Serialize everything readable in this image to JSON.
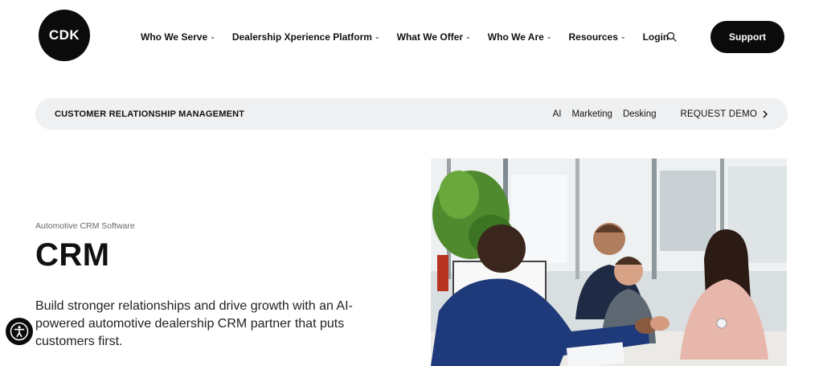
{
  "header": {
    "logo_text": "CDK",
    "nav": [
      {
        "label": "Who We Serve",
        "has_dropdown": true
      },
      {
        "label": "Dealership Xperience Platform",
        "has_dropdown": true
      },
      {
        "label": "What We Offer",
        "has_dropdown": true
      },
      {
        "label": "Who We Are",
        "has_dropdown": true
      },
      {
        "label": "Resources",
        "has_dropdown": true
      },
      {
        "label": "Login",
        "has_dropdown": false
      }
    ],
    "search_icon": "search-icon",
    "support_label": "Support"
  },
  "subnav": {
    "title": "CUSTOMER RELATIONSHIP MANAGEMENT",
    "links": [
      "AI",
      "Marketing",
      "Desking"
    ],
    "demo_label": "REQUEST DEMO",
    "demo_icon": "chevron-right-icon"
  },
  "hero": {
    "eyebrow": "Automotive CRM Software",
    "title": "CRM",
    "description": "Build stronger relationships and drive growth with an AI-powered automotive dealership CRM partner that puts customers first."
  },
  "accessibility": {
    "icon": "accessibility-icon"
  },
  "colors": {
    "brand": "#0b0b0b",
    "subbar_bg": "#eff0f1",
    "text": "#111111"
  }
}
